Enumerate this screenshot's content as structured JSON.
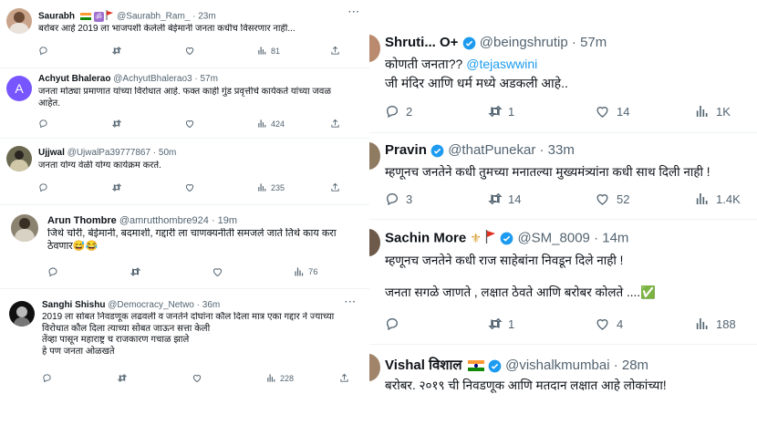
{
  "left_column": [
    {
      "name": "Saurabh",
      "handle": "@Saurabh_Ram_",
      "time": "23m",
      "text": [
        "बरोबर आहे 2019 ला भाजपशी केलेली बेईमानी जनता कधीच विसरणार नाही..."
      ],
      "replies": "",
      "retweets": "",
      "likes": "",
      "views": "81"
    },
    {
      "name": "Achyut Bhalerao",
      "handle": "@AchyutBhalerao3",
      "time": "57m",
      "avatar_letter": "A",
      "text": [
        "जनता मोठ्या प्रमाणात यांच्या विरोधात आहे.  फक्त काही गुंड प्रवृत्तीचे कार्यकर्ते  यांच्या जवळ",
        "आहेत."
      ],
      "views": "424"
    },
    {
      "name": "Ujjwal",
      "handle": "@UjwalPa39777867",
      "time": "50m",
      "text": [
        "जनता योग्य वेळी योग्य कार्यक्रम करते."
      ],
      "views": "235"
    },
    {
      "name": "Arun Thombre",
      "handle": "@amrutthombre924",
      "time": "19m",
      "text": [
        "जिथे चोरी, बेईमानी, बदमाशी, गद्दारी ला चाणक्यनीती समजले जाते तिथे काय करा",
        "ठेवणार😅😂"
      ],
      "views": "76"
    },
    {
      "name": "Sanghi Shishu",
      "handle": "@Democracy_Netwo",
      "time": "36m",
      "text": [
        "2019 ला सोबत निवडणूक लढवली व जनतेने दोघांना कौल दिला मात्र एका गद्दार ने ज्याच्या",
        "विरोधात कौल दिला त्याच्या सोबत जाऊन सत्ता केली",
        "तेंव्हा पासून महाराष्ट्र च राजकारण गचाळ झाले",
        "हे पण जनता ओळखते"
      ],
      "views": "228"
    }
  ],
  "right_column": [
    {
      "name": "Shruti... O+",
      "handle": "@beingshrutip",
      "time": "57m",
      "text_prefix": "कोणती जनता?? ",
      "mention": "@tejaswwini",
      "text": [
        "जी मंदिर आणि धर्म मध्ये अडकली आहे.."
      ],
      "replies": "2",
      "retweets": "1",
      "likes": "14",
      "views": "1K"
    },
    {
      "name": "Pravin",
      "handle": "@thatPunekar",
      "time": "33m",
      "text": [
        "म्हणूनच जनतेने कधी तुमच्या मनातल्या मुख्यमंत्र्यांना कधी साथ दिली नाही !"
      ],
      "replies": "3",
      "retweets": "14",
      "likes": "52",
      "views": "1.4K"
    },
    {
      "name": "Sachin More",
      "handle": "@SM_8009",
      "time": "14m",
      "text": [
        "म्हणूनच जनतेने कधी राज साहेबांना निवडून दिले नाही !",
        "",
        "जनता सगळे जाणते , लक्षात ठेवते आणि बरोबर कोलते ....✅"
      ],
      "replies": "",
      "retweets": "1",
      "likes": "4",
      "views": "188"
    },
    {
      "name": "Vishal विशाल",
      "handle": "@vishalkmumbai",
      "time": "28m",
      "text": [
        "बरोबर. २०१९ ची निवडणूक आणि मतदान लक्षात आहे लोकांच्या!"
      ]
    }
  ],
  "colors": {
    "muted": "#536471",
    "link": "#1d9bf0",
    "verified": "#1d9bf0",
    "separator": "#eff3f4",
    "achyut_avatar": "#7856ff"
  },
  "icons": [
    "reply-icon",
    "retweet-icon",
    "like-icon",
    "views-icon",
    "share-icon",
    "verified-icon",
    "india-flag-icon",
    "om-icon",
    "flag-icon",
    "fleur-icon",
    "more-icon"
  ]
}
